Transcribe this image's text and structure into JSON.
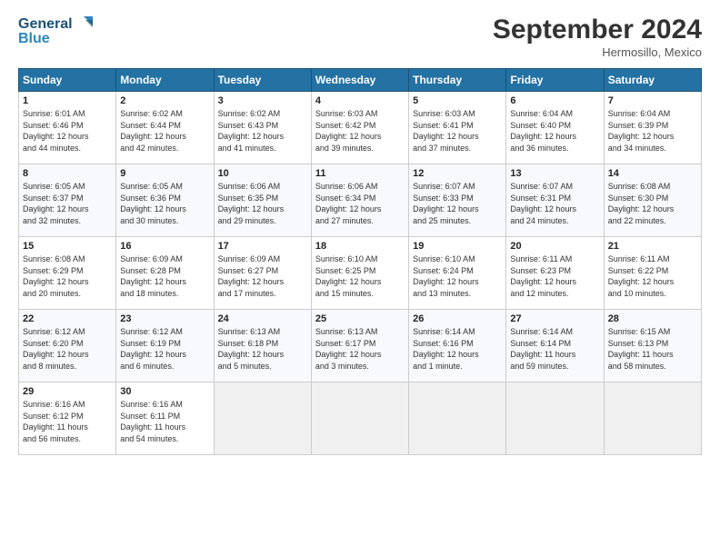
{
  "header": {
    "logo_line1": "General",
    "logo_line2": "Blue",
    "month_title": "September 2024",
    "subtitle": "Hermosillo, Mexico"
  },
  "days_of_week": [
    "Sunday",
    "Monday",
    "Tuesday",
    "Wednesday",
    "Thursday",
    "Friday",
    "Saturday"
  ],
  "weeks": [
    [
      {
        "day": "1",
        "info": "Sunrise: 6:01 AM\nSunset: 6:46 PM\nDaylight: 12 hours\nand 44 minutes."
      },
      {
        "day": "2",
        "info": "Sunrise: 6:02 AM\nSunset: 6:44 PM\nDaylight: 12 hours\nand 42 minutes."
      },
      {
        "day": "3",
        "info": "Sunrise: 6:02 AM\nSunset: 6:43 PM\nDaylight: 12 hours\nand 41 minutes."
      },
      {
        "day": "4",
        "info": "Sunrise: 6:03 AM\nSunset: 6:42 PM\nDaylight: 12 hours\nand 39 minutes."
      },
      {
        "day": "5",
        "info": "Sunrise: 6:03 AM\nSunset: 6:41 PM\nDaylight: 12 hours\nand 37 minutes."
      },
      {
        "day": "6",
        "info": "Sunrise: 6:04 AM\nSunset: 6:40 PM\nDaylight: 12 hours\nand 36 minutes."
      },
      {
        "day": "7",
        "info": "Sunrise: 6:04 AM\nSunset: 6:39 PM\nDaylight: 12 hours\nand 34 minutes."
      }
    ],
    [
      {
        "day": "8",
        "info": "Sunrise: 6:05 AM\nSunset: 6:37 PM\nDaylight: 12 hours\nand 32 minutes."
      },
      {
        "day": "9",
        "info": "Sunrise: 6:05 AM\nSunset: 6:36 PM\nDaylight: 12 hours\nand 30 minutes."
      },
      {
        "day": "10",
        "info": "Sunrise: 6:06 AM\nSunset: 6:35 PM\nDaylight: 12 hours\nand 29 minutes."
      },
      {
        "day": "11",
        "info": "Sunrise: 6:06 AM\nSunset: 6:34 PM\nDaylight: 12 hours\nand 27 minutes."
      },
      {
        "day": "12",
        "info": "Sunrise: 6:07 AM\nSunset: 6:33 PM\nDaylight: 12 hours\nand 25 minutes."
      },
      {
        "day": "13",
        "info": "Sunrise: 6:07 AM\nSunset: 6:31 PM\nDaylight: 12 hours\nand 24 minutes."
      },
      {
        "day": "14",
        "info": "Sunrise: 6:08 AM\nSunset: 6:30 PM\nDaylight: 12 hours\nand 22 minutes."
      }
    ],
    [
      {
        "day": "15",
        "info": "Sunrise: 6:08 AM\nSunset: 6:29 PM\nDaylight: 12 hours\nand 20 minutes."
      },
      {
        "day": "16",
        "info": "Sunrise: 6:09 AM\nSunset: 6:28 PM\nDaylight: 12 hours\nand 18 minutes."
      },
      {
        "day": "17",
        "info": "Sunrise: 6:09 AM\nSunset: 6:27 PM\nDaylight: 12 hours\nand 17 minutes."
      },
      {
        "day": "18",
        "info": "Sunrise: 6:10 AM\nSunset: 6:25 PM\nDaylight: 12 hours\nand 15 minutes."
      },
      {
        "day": "19",
        "info": "Sunrise: 6:10 AM\nSunset: 6:24 PM\nDaylight: 12 hours\nand 13 minutes."
      },
      {
        "day": "20",
        "info": "Sunrise: 6:11 AM\nSunset: 6:23 PM\nDaylight: 12 hours\nand 12 minutes."
      },
      {
        "day": "21",
        "info": "Sunrise: 6:11 AM\nSunset: 6:22 PM\nDaylight: 12 hours\nand 10 minutes."
      }
    ],
    [
      {
        "day": "22",
        "info": "Sunrise: 6:12 AM\nSunset: 6:20 PM\nDaylight: 12 hours\nand 8 minutes."
      },
      {
        "day": "23",
        "info": "Sunrise: 6:12 AM\nSunset: 6:19 PM\nDaylight: 12 hours\nand 6 minutes."
      },
      {
        "day": "24",
        "info": "Sunrise: 6:13 AM\nSunset: 6:18 PM\nDaylight: 12 hours\nand 5 minutes."
      },
      {
        "day": "25",
        "info": "Sunrise: 6:13 AM\nSunset: 6:17 PM\nDaylight: 12 hours\nand 3 minutes."
      },
      {
        "day": "26",
        "info": "Sunrise: 6:14 AM\nSunset: 6:16 PM\nDaylight: 12 hours\nand 1 minute."
      },
      {
        "day": "27",
        "info": "Sunrise: 6:14 AM\nSunset: 6:14 PM\nDaylight: 11 hours\nand 59 minutes."
      },
      {
        "day": "28",
        "info": "Sunrise: 6:15 AM\nSunset: 6:13 PM\nDaylight: 11 hours\nand 58 minutes."
      }
    ],
    [
      {
        "day": "29",
        "info": "Sunrise: 6:16 AM\nSunset: 6:12 PM\nDaylight: 11 hours\nand 56 minutes."
      },
      {
        "day": "30",
        "info": "Sunrise: 6:16 AM\nSunset: 6:11 PM\nDaylight: 11 hours\nand 54 minutes."
      },
      {
        "day": "",
        "info": ""
      },
      {
        "day": "",
        "info": ""
      },
      {
        "day": "",
        "info": ""
      },
      {
        "day": "",
        "info": ""
      },
      {
        "day": "",
        "info": ""
      }
    ]
  ]
}
